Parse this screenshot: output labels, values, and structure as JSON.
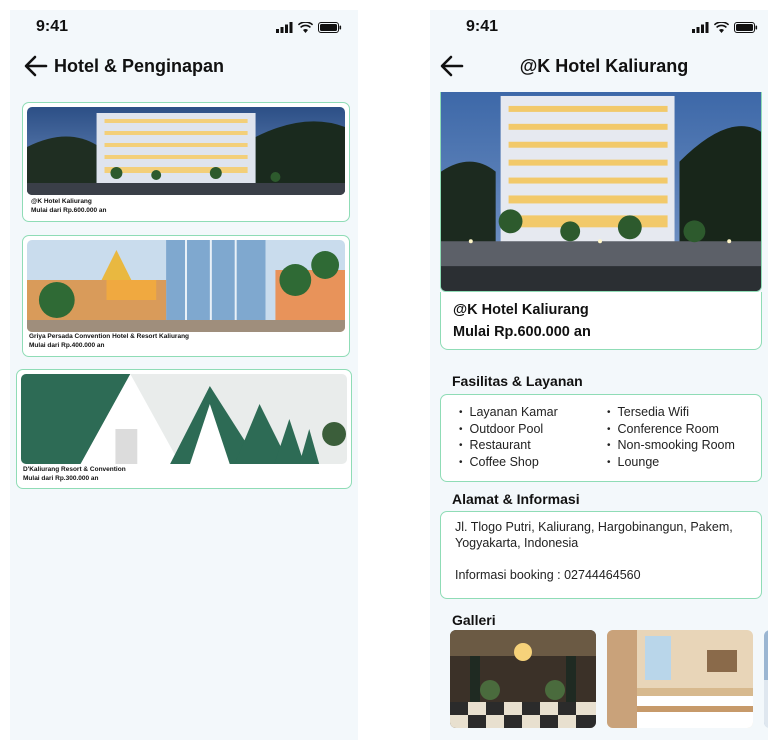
{
  "status_bar": {
    "time": "9:41"
  },
  "list_screen": {
    "title": "Hotel & Penginapan",
    "hotels": [
      {
        "name": "@K Hotel Kaliurang",
        "price": "Mulai dari Rp.600.000 an"
      },
      {
        "name": "Griya Persada Convention Hotel & Resort Kaliurang",
        "price": "Mulai dari Rp.400.000 an"
      },
      {
        "name": "D'Kaliurang Resort & Convention",
        "price": "Mulai dari Rp.300.000 an"
      }
    ]
  },
  "detail_screen": {
    "title": "@K Hotel Kaliurang",
    "name": "@K Hotel Kaliurang",
    "price": "Mulai Rp.600.000 an",
    "facilities_title": "Fasilitas & Layanan",
    "facilities_left": [
      "Layanan Kamar",
      "Outdoor Pool",
      "Restaurant",
      "Coffee Shop"
    ],
    "facilities_right": [
      "Tersedia Wifi",
      "Conference Room",
      "Non-smooking Room",
      "Lounge"
    ],
    "address_title": "Alamat & Informasi",
    "address": "Jl. Tlogo Putri, Kaliurang, Hargobinangun, Pakem, Yogyakarta, Indonesia",
    "booking": "Informasi booking : 02744464560",
    "gallery_title": "Galleri"
  },
  "icons": [
    "back-arrow-icon",
    "signal-icon",
    "wifi-icon",
    "battery-icon"
  ],
  "colors": {
    "accent_border": "#8fdcb6",
    "background": "#f3f8fb"
  }
}
